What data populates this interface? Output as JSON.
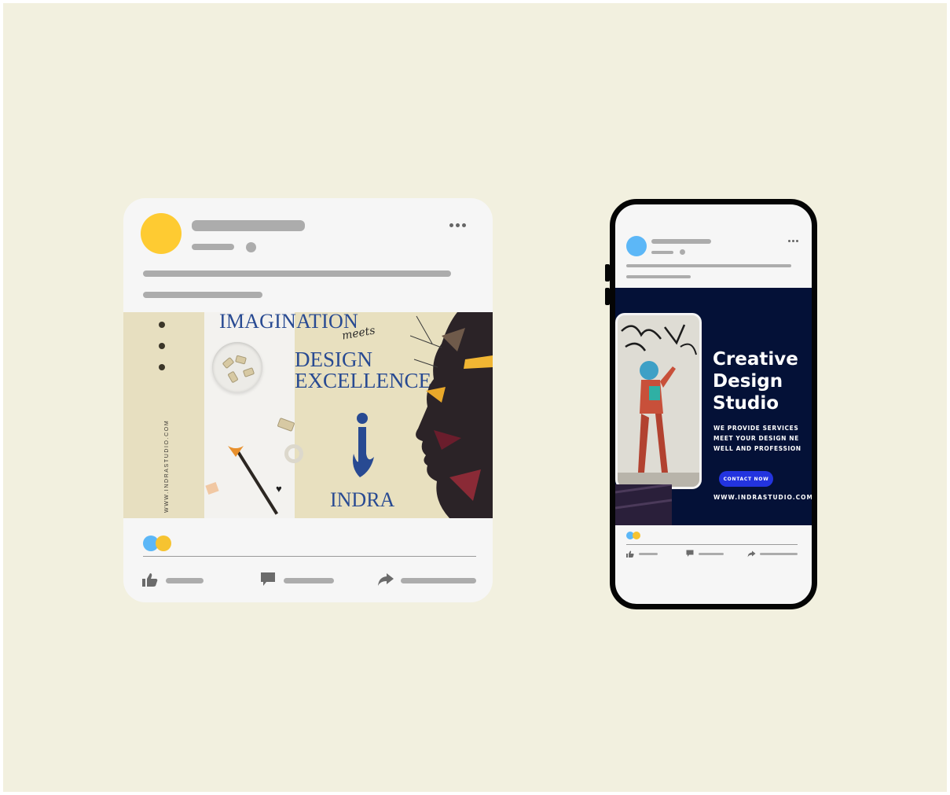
{
  "desktop_post": {
    "menu_icon": "more-horizontal-icon",
    "banner": {
      "side_url": "WWW.INDRASTUDIO.COM",
      "headline_1": "IMAGINATION",
      "connector": "meets",
      "headline_2": "DESIGN",
      "headline_3": "EXCELLENCE",
      "logo_icon": "indra-logo-icon",
      "brand": "INDRA"
    },
    "reactions": [
      "reaction-blue-icon",
      "reaction-yellow-icon"
    ],
    "actions": [
      "like-icon",
      "comment-icon",
      "share-icon"
    ]
  },
  "phone_post": {
    "menu_icon": "more-horizontal-icon",
    "banner": {
      "title_1": "Creative",
      "title_2": "Design",
      "title_3": "Studio",
      "body_1": "WE PROVIDE SERVICES",
      "body_2": "MEET YOUR DESIGN NE",
      "body_3": "WELL AND PROFESSION",
      "cta": "CONTACT NOW",
      "url": "WWW.INDRASTUDIO.COM"
    },
    "reactions": [
      "reaction-blue-icon",
      "reaction-yellow-icon"
    ],
    "actions": [
      "like-icon",
      "comment-icon",
      "share-icon"
    ]
  },
  "colors": {
    "background": "#f2f0df",
    "card": "#f6f6f6",
    "placeholder": "#acacac",
    "avatar_yellow": "#fecb32",
    "avatar_blue": "#5cb7f7",
    "brand_blue": "#284a92",
    "phone_banner": "#041137",
    "cta_blue": "#2334df"
  }
}
